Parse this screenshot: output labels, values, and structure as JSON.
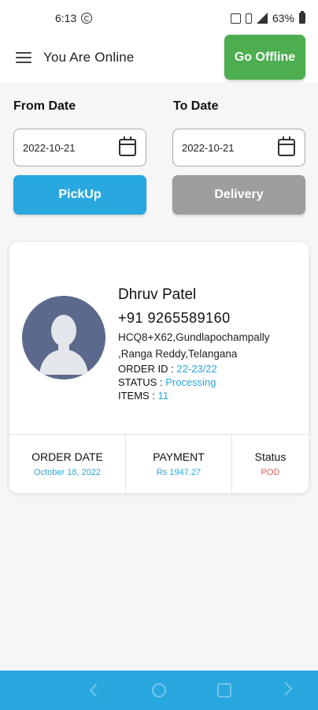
{
  "status_bar": {
    "time": "6:13",
    "battery_percent": "63%"
  },
  "header": {
    "status_text": "You Are Online",
    "offline_button": "Go Offline"
  },
  "filters": {
    "from_label": "From Date",
    "from_value": "2022-10-21",
    "to_label": "To Date",
    "to_value": "2022-10-21",
    "pickup_tab": "PickUp",
    "delivery_tab": "Delivery"
  },
  "order": {
    "customer_name": "Dhruv Patel",
    "phone": "+91 9265589160",
    "address_line1": "HCQ8+X62,Gundlapochampally",
    "address_line2": ",Ranga Reddy,Telangana",
    "order_id_label": "ORDER ID :",
    "order_id_value": "22-23/22",
    "status_label": "STATUS :",
    "status_value": "Processing",
    "items_label": "ITEMS :",
    "items_value": "11",
    "order_date_label": "ORDER DATE",
    "order_date_value": "October 18, 2022",
    "payment_label": "PAYMENT",
    "payment_value": "Rs 1947.27",
    "status_col_label": "Status",
    "status_col_value": "POD"
  },
  "colors": {
    "accent": "#29a7df",
    "online_green": "#4cae4f",
    "inactive_gray": "#9d9d9d",
    "pod_red": "#e05555"
  }
}
